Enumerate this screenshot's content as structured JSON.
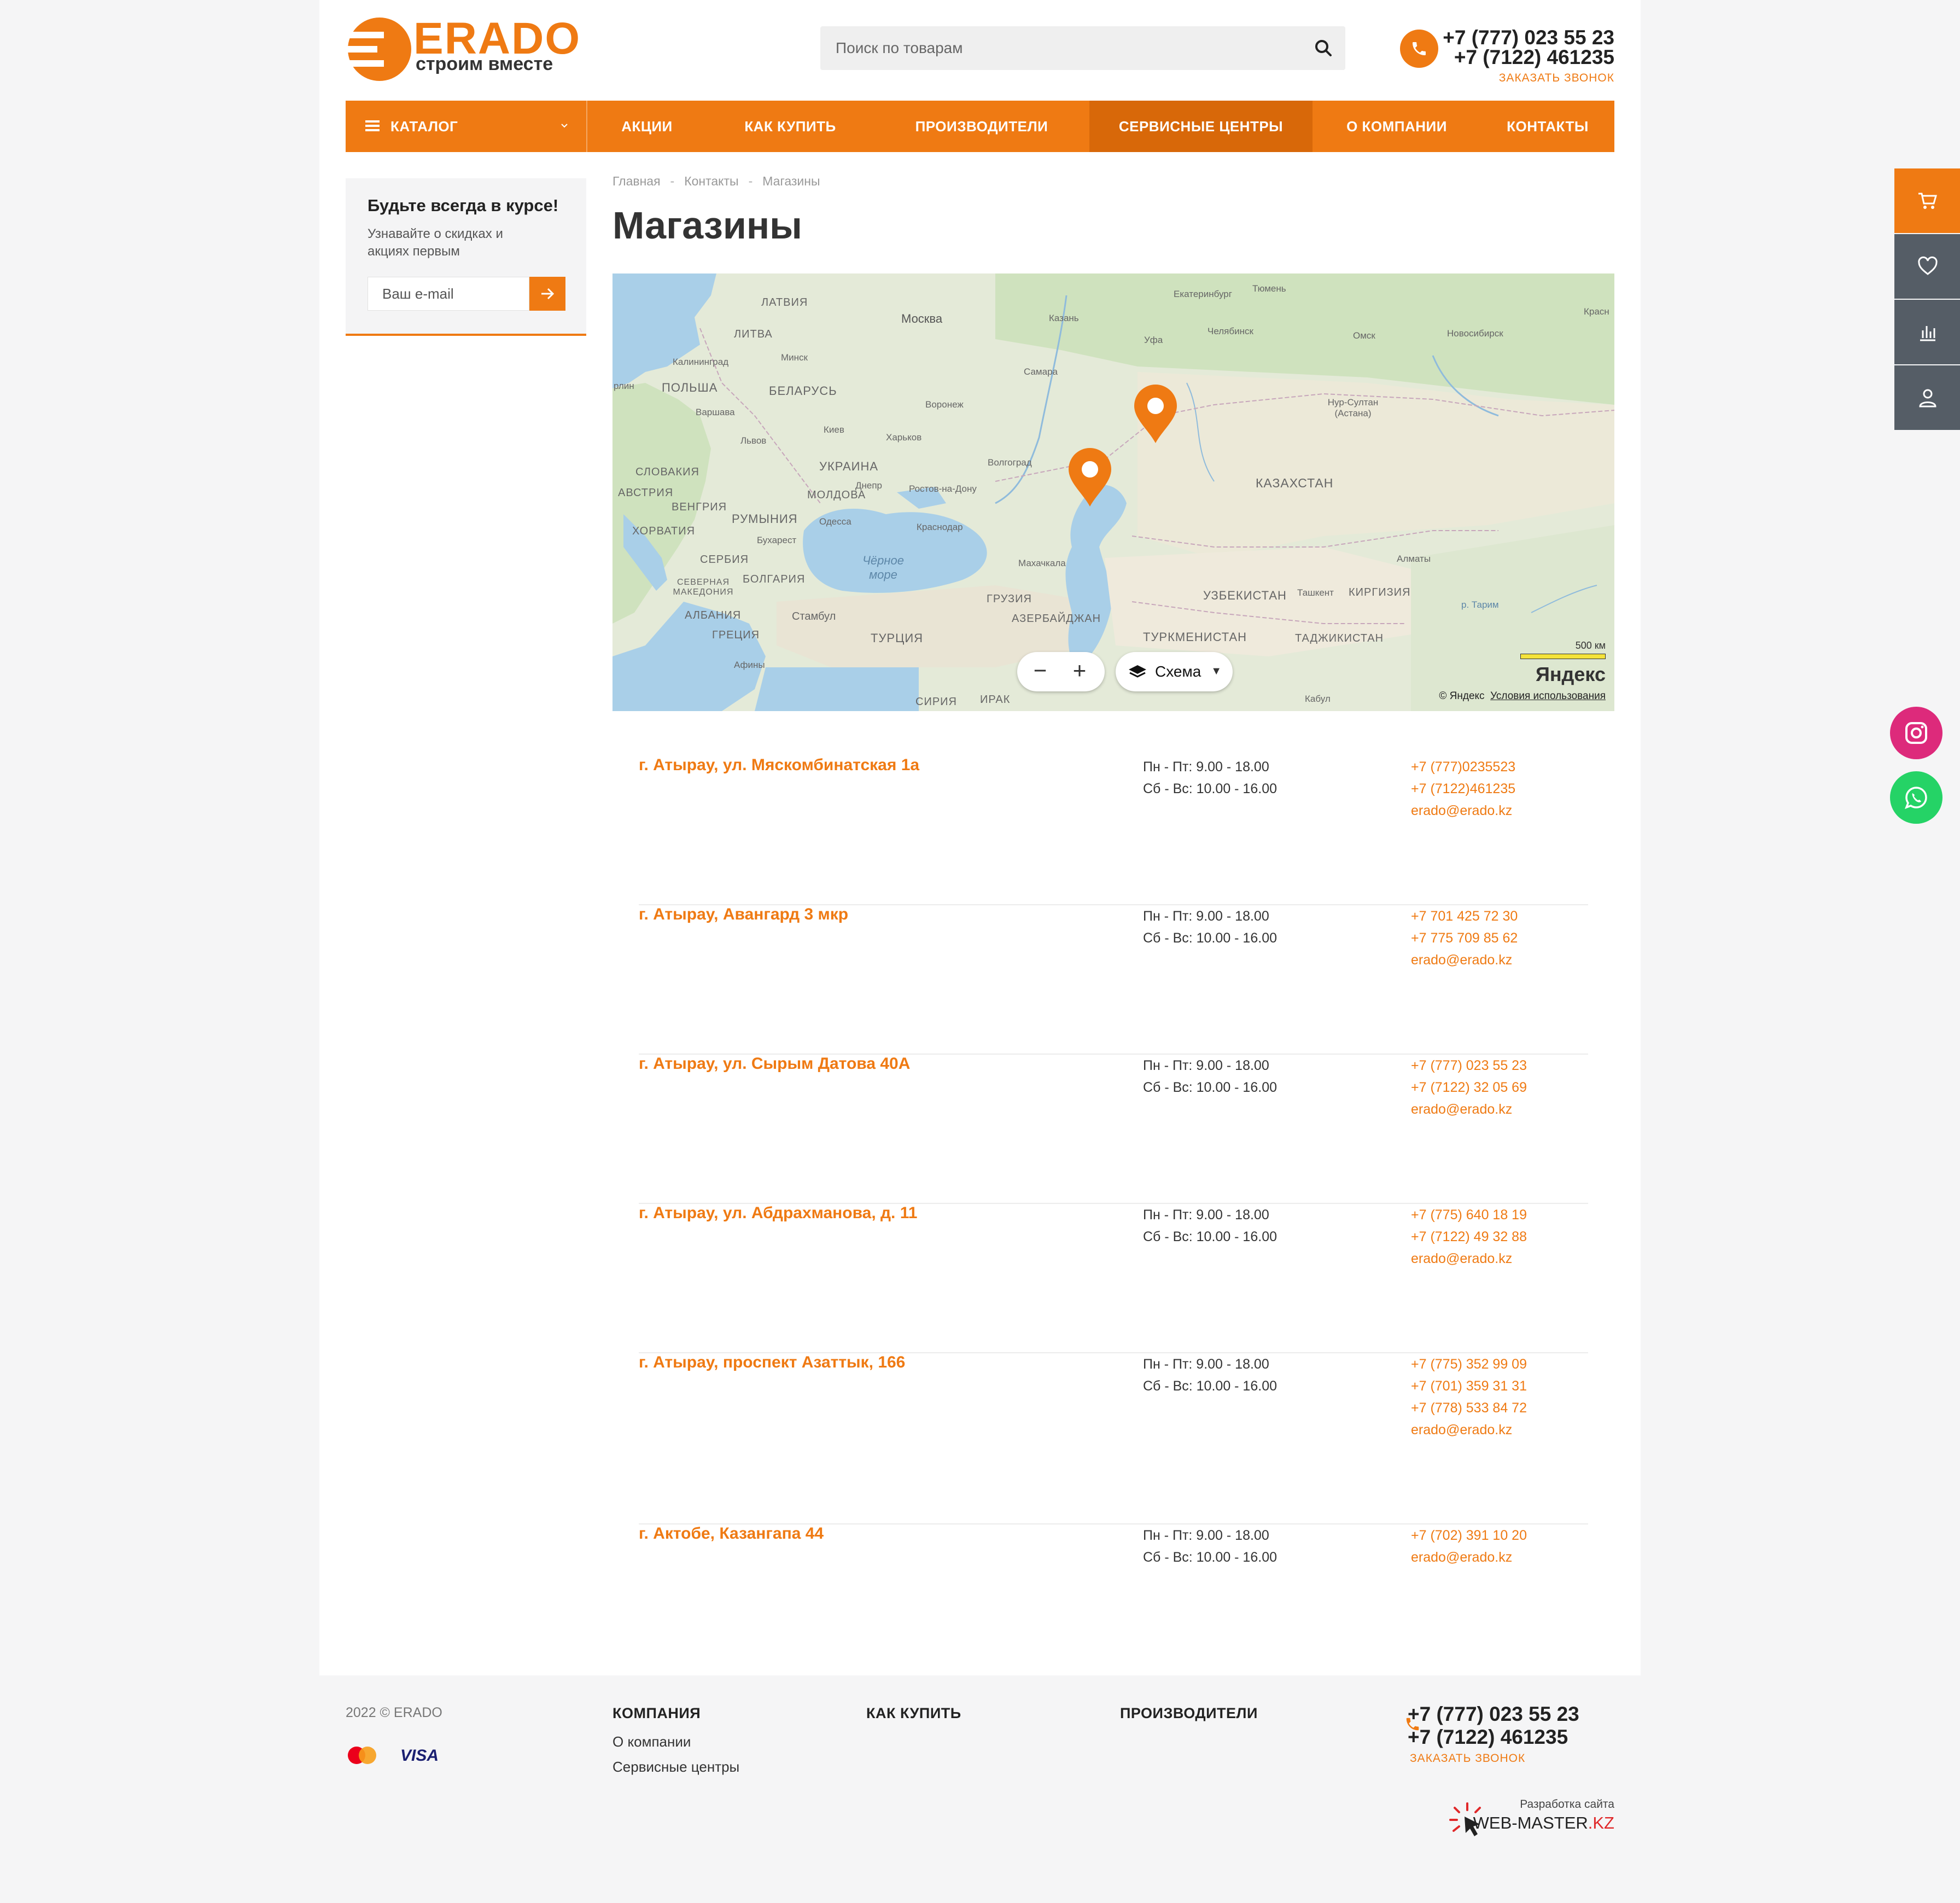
{
  "header": {
    "logo_text": "ERADO",
    "logo_tagline": "строим вместе",
    "search_placeholder": "Поиск по товарам",
    "phones": [
      "+7 (777) 023 55 23",
      "+7 (7122) 461235"
    ],
    "callback_label": "ЗАКАЗАТЬ ЗВОНОК"
  },
  "nav": {
    "catalog_label": "КАТАЛОГ",
    "items": [
      {
        "label": "АКЦИИ"
      },
      {
        "label": "КАК КУПИТЬ"
      },
      {
        "label": "ПРОИЗВОДИТЕЛИ"
      },
      {
        "label": "СЕРВИСНЫЕ ЦЕНТРЫ",
        "active": true
      },
      {
        "label": "О КОМПАНИИ"
      },
      {
        "label": "КОНТАКТЫ"
      }
    ]
  },
  "subscribe": {
    "title": "Будьте всегда в курсе!",
    "text": "Узнавайте о скидках и акциях первым",
    "input_placeholder": "Ваш e-mail"
  },
  "breadcrumb": [
    "Главная",
    "Контакты",
    "Магазины"
  ],
  "page_title": "Магазины",
  "map": {
    "labels": {
      "latvia": "ЛАТВИЯ",
      "lithuania": "ЛИТВА",
      "kaliningrad": "Калининград",
      "poland": "ПОЛЬША",
      "warsaw": "Варшава",
      "berlin": "рлин",
      "minsk": "Минск",
      "belarus": "БЕЛАРУСЬ",
      "moscow": "Москва",
      "kazan": "Казань",
      "ekb": "Екатеринбург",
      "tyumen": "Тюмень",
      "ufa": "Уфа",
      "chelyabinsk": "Челябинск",
      "omsk": "Омск",
      "novosibirsk": "Новосибирск",
      "krasn": "Красн",
      "samara": "Самара",
      "voronezh": "Воронеж",
      "kharkov": "Харьков",
      "kiev": "Киев",
      "lvov": "Львов",
      "ukraine": "УКРАИНА",
      "slovakia": "СЛОВАКИЯ",
      "austria": "АВСТРИЯ",
      "hungary": "ВЕНГРИЯ",
      "croatia": "ХОРВАТИЯ",
      "romania": "РУМЫНИЯ",
      "moldova": "МОЛДОВА",
      "odessa": "Одесса",
      "dnepr": "Днепр",
      "rostov": "Ростов-на-Дону",
      "volgograd": "Волгоград",
      "krasnodar": "Краснодар",
      "bucharest": "Бухарест",
      "serbia": "СЕРБИЯ",
      "bulgaria": "БОЛГАРИЯ",
      "macedonia": "СЕВЕРНАЯ МАКЕДОНИЯ",
      "albania": "АЛБАНИЯ",
      "greece": "ГРЕЦИЯ",
      "athens": "Афины",
      "istanbul": "Стамбул",
      "turkey": "ТУРЦИЯ",
      "black_sea": "Чёрное море",
      "makhachkala": "Махачкала",
      "georgia": "ГРУЗИЯ",
      "azerbaijan": "АЗЕРБАЙДЖАН",
      "kazakhstan": "КАЗАХСТАН",
      "nur_sultan": "Нур-Султан (Астана)",
      "almaty": "Алматы",
      "uzbekistan": "УЗБЕКИСТАН",
      "tashkent": "Ташкент",
      "kyrgyzstan": "КИРГИЗИЯ",
      "turkmenistan": "ТУРКМЕНИСТАН",
      "tajikistan": "ТАДЖИКИСТАН",
      "tarim": "р. Тарим",
      "syria": "СИРИЯ",
      "iraq": "ИРАК",
      "kabul": "Кабул"
    },
    "scheme_label": "Схема",
    "scale_label": "500 км",
    "provider": "Яндекс",
    "copyright": "© Яндекс",
    "terms": "Условия использования"
  },
  "stores": [
    {
      "address": "г. Атырау, ул. Мяскомбинатская 1а",
      "hours": [
        "Пн - Пт: 9.00 - 18.00",
        "Сб - Вс: 10.00 - 16.00"
      ],
      "contacts": [
        "+7 (777)0235523",
        "+7 (7122)461235",
        "erado@erado.kz"
      ]
    },
    {
      "address": "г. Атырау, Авангард 3 мкр",
      "hours": [
        "Пн - Пт: 9.00 - 18.00",
        "Сб - Вс: 10.00 - 16.00"
      ],
      "contacts": [
        "+7 701 425 72 30",
        "+7 775 709 85 62",
        "erado@erado.kz"
      ]
    },
    {
      "address": "г. Атырау, ул. Сырым Датова 40А",
      "hours": [
        "Пн - Пт: 9.00 - 18.00",
        "Сб - Вс: 10.00 - 16.00"
      ],
      "contacts": [
        "+7 (777) 023 55 23",
        "+7 (7122) 32 05 69",
        "erado@erado.kz"
      ]
    },
    {
      "address": "г. Атырау, ул. Абдрахманова, д. 11",
      "hours": [
        "Пн - Пт: 9.00 - 18.00",
        "Сб - Вс: 10.00 - 16.00"
      ],
      "contacts": [
        "+7 (775) 640 18 19",
        "+7 (7122) 49 32 88",
        "erado@erado.kz"
      ]
    },
    {
      "address": "г. Атырау, проспект Азаттык, 166",
      "hours": [
        "Пн - Пт: 9.00 - 18.00",
        "Сб - Вс: 10.00 - 16.00"
      ],
      "contacts": [
        "+7 (775) 352 99 09",
        "+7 (701) 359 31 31",
        "+7 (778) 533 84 72",
        "erado@erado.kz"
      ]
    },
    {
      "address": "г. Актобе, Казангапа 44",
      "hours": [
        "Пн - Пт: 9.00 - 18.00",
        "Сб - Вс: 10.00 - 16.00"
      ],
      "contacts": [
        "+7 (702) 391 10 20",
        "erado@erado.kz"
      ]
    }
  ],
  "footer": {
    "copyright": "2022 © ERADO",
    "cards": [
      "MasterCard",
      "VISA"
    ],
    "columns": [
      {
        "title": "КОМПАНИЯ",
        "links": [
          {
            "label": "О компании"
          },
          {
            "label": "Сервисные центры",
            "active": true
          }
        ]
      },
      {
        "title": "КАК КУПИТЬ",
        "links": []
      },
      {
        "title": "ПРОИЗВОДИТЕЛИ",
        "links": []
      }
    ],
    "phones": [
      "+7 (777) 023 55 23",
      "+7 (7122) 461235"
    ],
    "callback_label": "ЗАКАЗАТЬ ЗВОНОК",
    "developer_caption": "Разработка сайта",
    "developer_name": "WEB-MASTER",
    "developer_tld": ".KZ"
  },
  "widgets": [
    "cart-icon",
    "heart-icon",
    "compare-icon",
    "user-icon"
  ],
  "social": [
    "instagram-icon",
    "whatsapp-icon"
  ],
  "colors": {
    "accent": "#ef7a13",
    "accent_dark": "#d86809",
    "widget_dark": "#555d66",
    "instagram": "#dd2a7b",
    "whatsapp": "#25d366"
  }
}
